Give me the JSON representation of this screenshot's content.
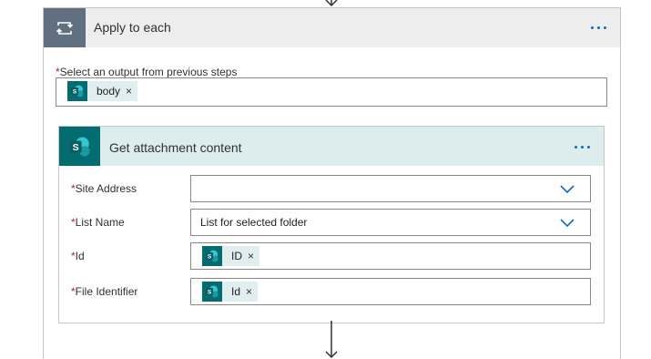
{
  "apply_to_each": {
    "title": "Apply to each",
    "icon": "loop-icon",
    "select_output": {
      "required_marker": "*",
      "label": "Select an output from previous steps",
      "tokens": [
        {
          "label": "body",
          "remove": "×",
          "icon": "sharepoint-icon"
        }
      ]
    }
  },
  "get_attachment_content": {
    "title": "Get attachment content",
    "icon": "sharepoint-icon",
    "fields": [
      {
        "label": "Site Address",
        "required_marker": "*",
        "value": "",
        "type": "dropdown"
      },
      {
        "label": "List Name",
        "required_marker": "*",
        "value": "List for selected folder",
        "type": "dropdown"
      },
      {
        "label": "Id",
        "required_marker": "*",
        "type": "token",
        "token": {
          "label": "ID",
          "remove": "×",
          "icon": "sharepoint-icon"
        }
      },
      {
        "label": "File Identifier",
        "required_marker": "*",
        "type": "token",
        "token": {
          "label": "Id",
          "remove": "×",
          "icon": "sharepoint-icon"
        }
      }
    ]
  },
  "colors": {
    "loop_header_icon_bg": "#607080",
    "loop_header_bg": "#ededed",
    "sharepoint_teal": "#036c70",
    "action_header_bg": "#ddedee",
    "token_bg": "#e1eef0",
    "accent_blue": "#0f6cbd",
    "required_red": "#a4262c"
  }
}
